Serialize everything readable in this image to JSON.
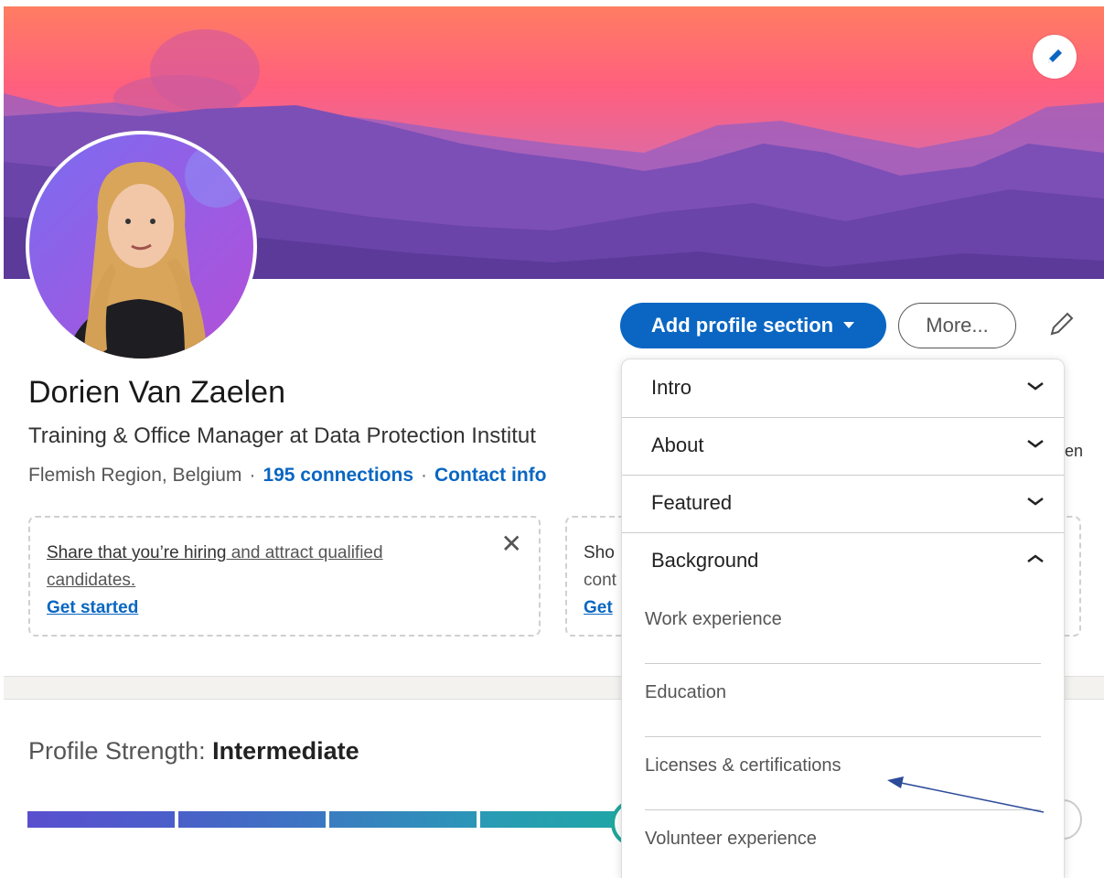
{
  "profile": {
    "name": "Dorien Van Zaelen",
    "headline": "Training & Office Manager at Data Protection Institut",
    "location": "Flemish Region, Belgium",
    "connections": "195 connections",
    "contact": "Contact info",
    "separator": "·",
    "right_truncated": "en"
  },
  "actions": {
    "add_section": "Add profile section",
    "more": "More..."
  },
  "cards": {
    "hiring": {
      "underlined": "Share that you’re hiring",
      "rest": " and attract qualified candidates.",
      "cta": "Get started",
      "close": "✕"
    },
    "second": {
      "line1": "Sho",
      "line2": "cont",
      "cta": "Get"
    }
  },
  "strength": {
    "label": "Profile Strength: ",
    "level": "Intermediate",
    "segment_colors": [
      "#5a4fcf",
      "#3f6fc4",
      "#2b8cbf",
      "#1fa6a6"
    ]
  },
  "dropdown": {
    "sections": [
      {
        "label": "Intro",
        "state": "collapsed"
      },
      {
        "label": "About",
        "state": "collapsed"
      },
      {
        "label": "Featured",
        "state": "collapsed"
      },
      {
        "label": "Background",
        "state": "expanded"
      }
    ],
    "background_items": [
      "Work experience",
      "Education",
      "Licenses & certifications",
      "Volunteer experience"
    ]
  },
  "colors": {
    "accent": "#0a66c2",
    "annotation_arrow": "#2b4a9a"
  }
}
